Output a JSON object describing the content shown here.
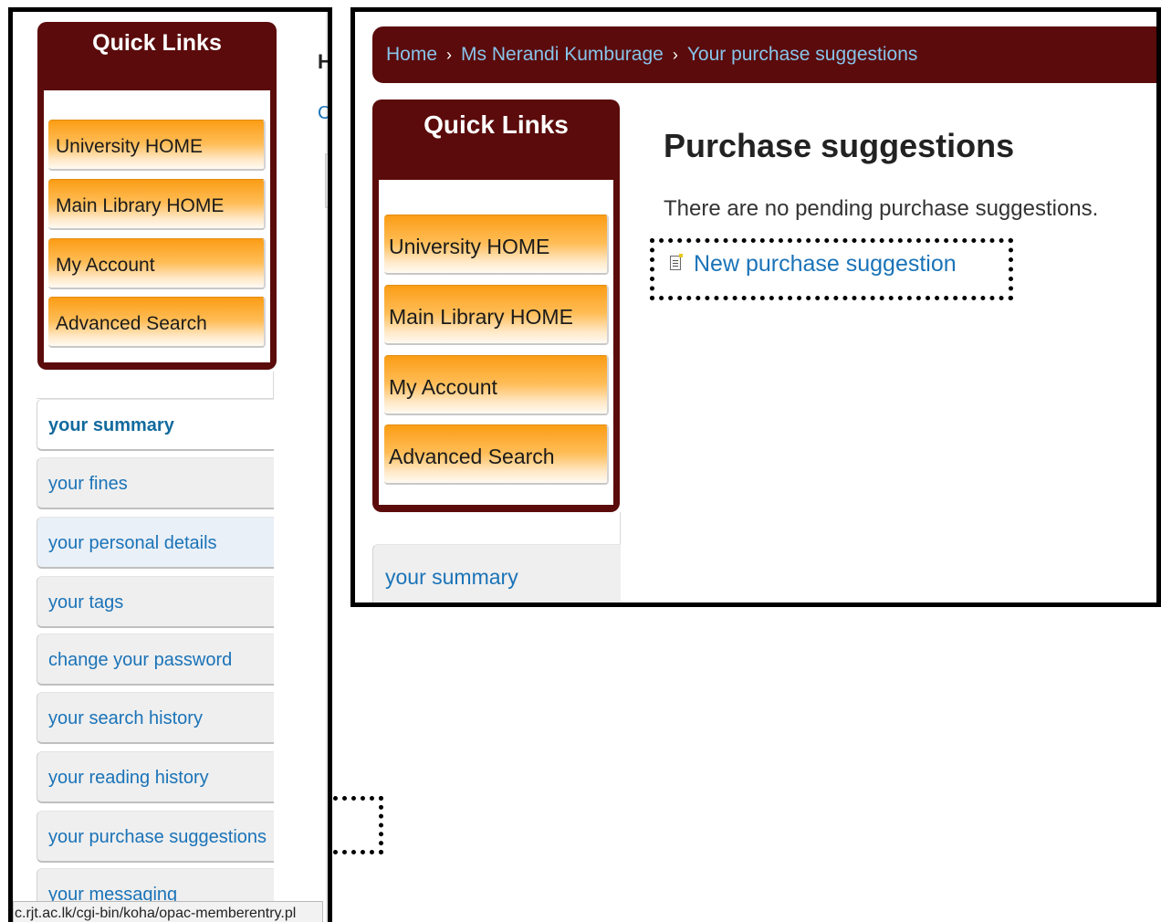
{
  "left_panel": {
    "quick_links": {
      "title": "Quick Links",
      "items": [
        "University HOME",
        "Main Library HOME",
        "My Account",
        "Advanced Search"
      ]
    },
    "edge_fragments": {
      "heading_letter": "H",
      "link_letter": "C"
    },
    "tabs": [
      "your summary",
      "your fines",
      "your personal details",
      "your tags",
      "change your password",
      "your search history",
      "your reading history",
      "your purchase suggestions",
      "your messaging"
    ],
    "active_tab": "your summary",
    "status_url": "c.rjt.ac.lk/cgi-bin/koha/opac-memberentry.pl"
  },
  "right_panel": {
    "breadcrumb": [
      "Home",
      "Ms Nerandi Kumburage",
      "Your purchase suggestions"
    ],
    "breadcrumb_separator": "›",
    "quick_links": {
      "title": "Quick Links",
      "items": [
        "University HOME",
        "Main Library HOME",
        "My Account",
        "Advanced Search"
      ]
    },
    "tab": "your summary",
    "heading": "Purchase suggestions",
    "message": "There are no pending purchase suggestions.",
    "new_link": "New purchase suggestion",
    "new_link_icon": "document-icon"
  },
  "colors": {
    "maroon": "#5b0b0b",
    "orange": "#fb9d16",
    "link_blue": "#1a73b8",
    "breadcrumb_blue": "#88c4ea"
  }
}
